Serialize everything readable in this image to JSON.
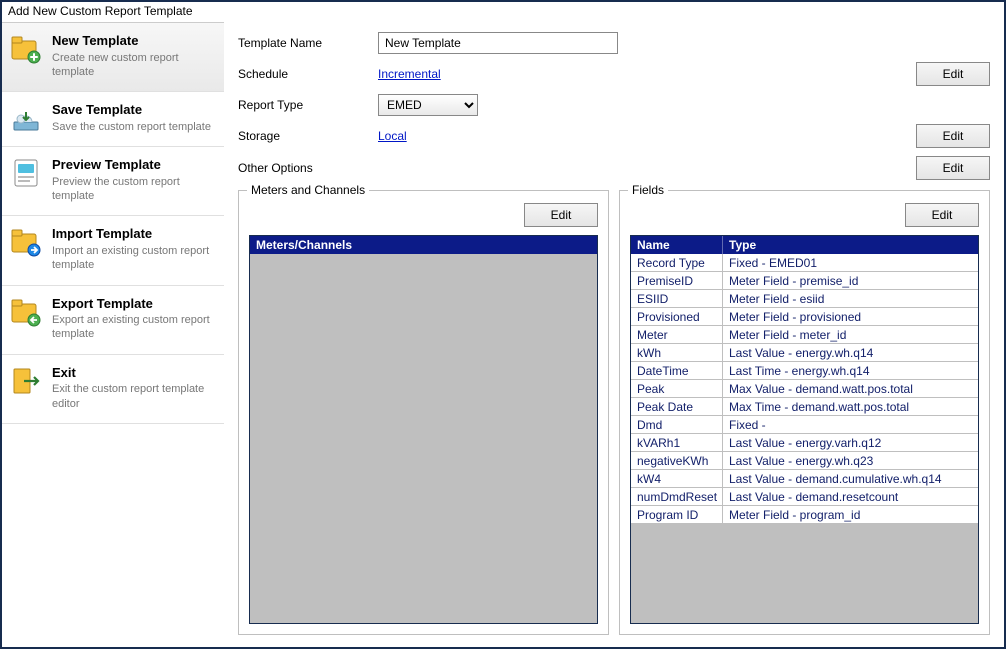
{
  "title": "Add New Custom Report Template",
  "sidebar": {
    "items": [
      {
        "label": "New Template",
        "sub": "Create new custom report template"
      },
      {
        "label": "Save Template",
        "sub": "Save the custom report template"
      },
      {
        "label": "Preview Template",
        "sub": "Preview the custom report template"
      },
      {
        "label": "Import Template",
        "sub": "Import an existing custom report template"
      },
      {
        "label": "Export Template",
        "sub": "Export an existing custom report template"
      },
      {
        "label": "Exit",
        "sub": "Exit the custom report template editor"
      }
    ]
  },
  "form": {
    "templateName": {
      "label": "Template Name",
      "value": "New Template"
    },
    "schedule": {
      "label": "Schedule",
      "value": "Incremental",
      "editLabel": "Edit"
    },
    "reportType": {
      "label": "Report Type",
      "value": "EMED"
    },
    "storage": {
      "label": "Storage",
      "value": "Local",
      "editLabel": "Edit"
    },
    "otherOptions": {
      "label": "Other Options",
      "editLabel": "Edit"
    }
  },
  "panels": {
    "meters": {
      "title": "Meters and Channels",
      "editLabel": "Edit",
      "headers": [
        "Meters/Channels"
      ],
      "rows": []
    },
    "fields": {
      "title": "Fields",
      "editLabel": "Edit",
      "headers": [
        "Name",
        "Type"
      ],
      "rows": [
        {
          "name": "Record Type",
          "type": "Fixed - EMED01"
        },
        {
          "name": "PremiseID",
          "type": "Meter Field - premise_id"
        },
        {
          "name": "ESIID",
          "type": "Meter Field - esiid"
        },
        {
          "name": "Provisioned",
          "type": "Meter Field - provisioned"
        },
        {
          "name": "Meter",
          "type": "Meter Field - meter_id"
        },
        {
          "name": "kWh",
          "type": "Last Value - energy.wh.q14"
        },
        {
          "name": "DateTime",
          "type": "Last Time - energy.wh.q14"
        },
        {
          "name": "Peak",
          "type": "Max Value - demand.watt.pos.total"
        },
        {
          "name": "Peak Date",
          "type": "Max Time - demand.watt.pos.total"
        },
        {
          "name": "Dmd",
          "type": "Fixed -"
        },
        {
          "name": "kVARh1",
          "type": "Last Value - energy.varh.q12"
        },
        {
          "name": "negativeKWh",
          "type": "Last Value - energy.wh.q23"
        },
        {
          "name": "kW4",
          "type": "Last Value - demand.cumulative.wh.q14"
        },
        {
          "name": "numDmdReset",
          "type": "Last Value - demand.resetcount"
        },
        {
          "name": "Program ID",
          "type": "Meter Field - program_id"
        }
      ]
    }
  }
}
